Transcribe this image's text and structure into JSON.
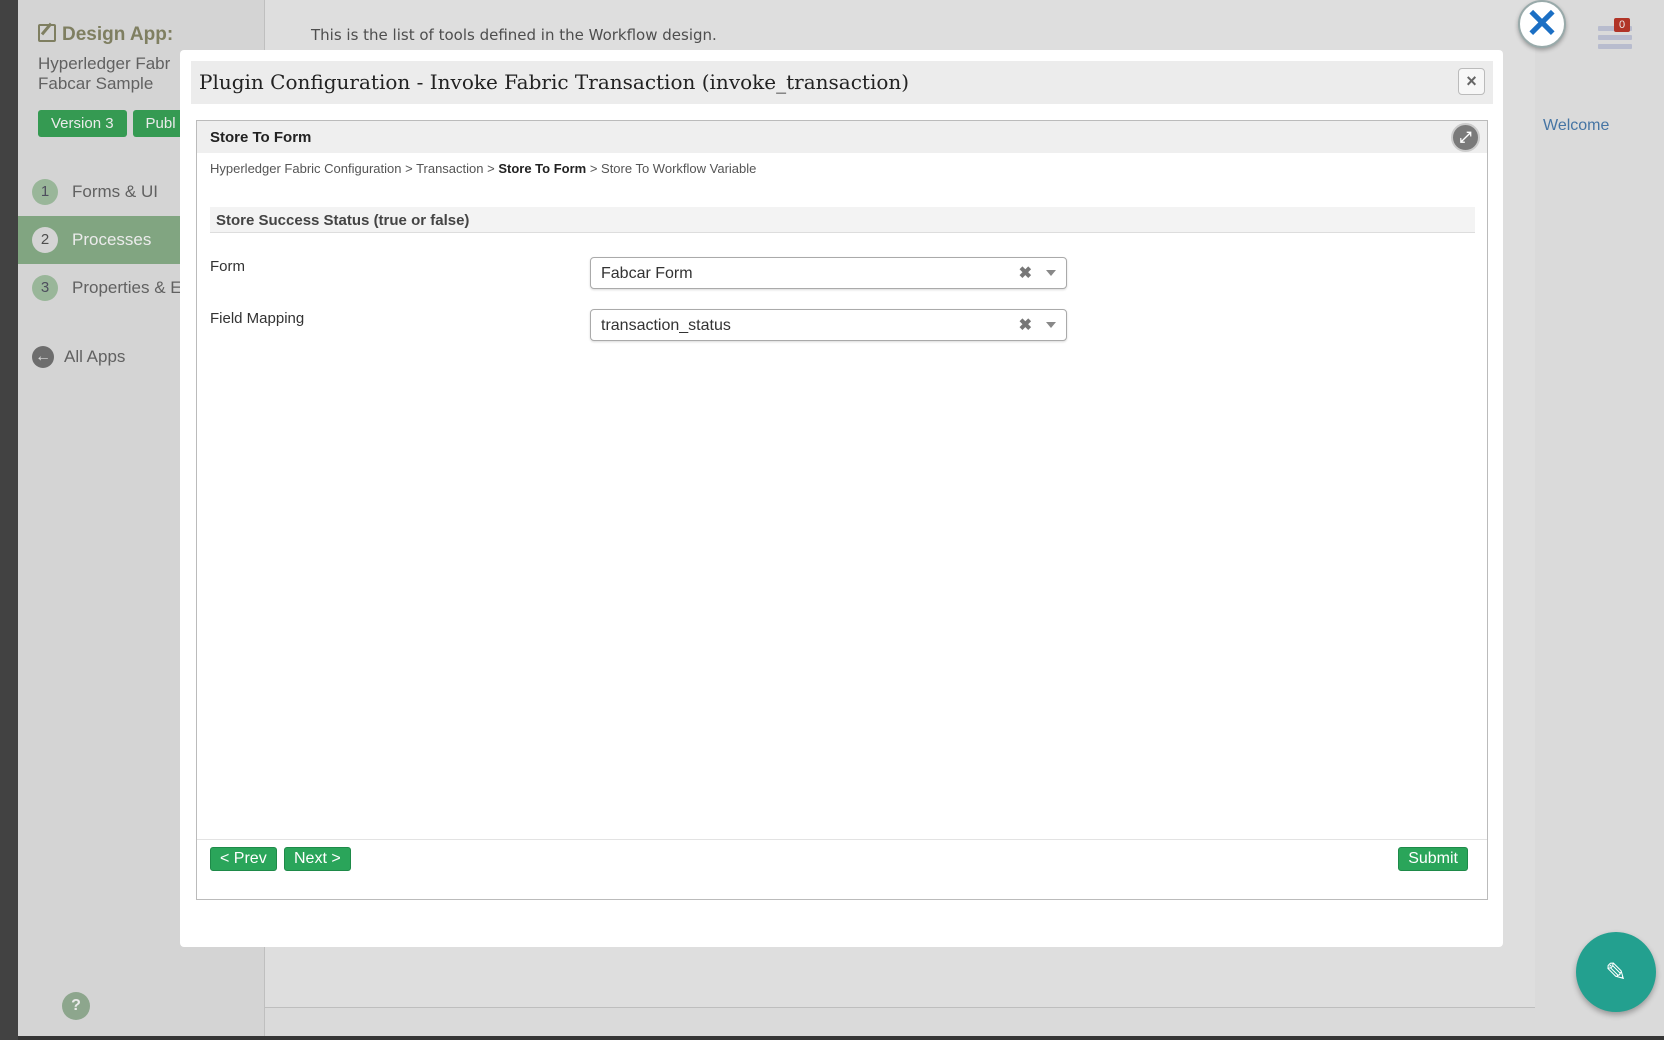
{
  "background": {
    "sidebar": {
      "title": "Design App:",
      "app_name_line1": "Hyperledger Fabr",
      "app_name_line2": "Fabcar Sample",
      "badges": [
        "Version 3",
        "Publ"
      ],
      "nav": [
        {
          "num": "1",
          "label": "Forms & UI"
        },
        {
          "num": "2",
          "label": "Processes"
        },
        {
          "num": "3",
          "label": "Properties & E"
        }
      ],
      "all_apps": "All Apps",
      "help": "?"
    },
    "main_intro": "This is the list of tools defined in the Workflow design.",
    "tray_badge": "0",
    "welcome": "Welcome"
  },
  "modal": {
    "title": "Plugin Configuration - Invoke Fabric Transaction (invoke_transaction)",
    "close": "×",
    "panel": {
      "title": "Store To Form",
      "breadcrumb": {
        "before": "Hyperledger Fabric Configuration > Transaction > ",
        "current": "Store To Form",
        "after": " > Store To Workflow Variable"
      },
      "section": "Store Success Status (true or false)",
      "fields": [
        {
          "label": "Form",
          "value": "Fabcar Form"
        },
        {
          "label": "Field Mapping",
          "value": "transaction_status"
        }
      ]
    },
    "buttons": {
      "prev": "< Prev",
      "next": "Next >",
      "submit": "Submit"
    }
  }
}
